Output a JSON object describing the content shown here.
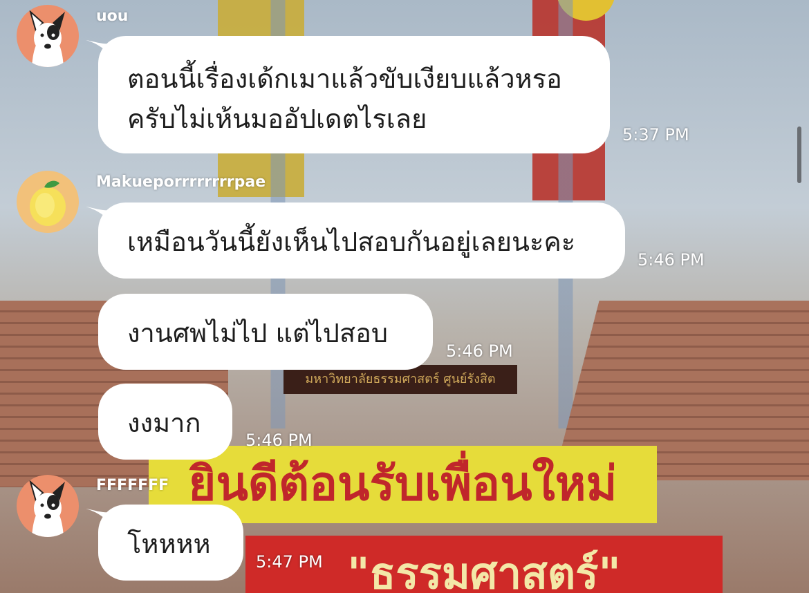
{
  "background": {
    "plaque_text": "มหาวิทยาลัยธรรมศาสตร์ ศูนย์รังสิต",
    "banner_top_text": "ยินดีต้อนรับเพื่อนใหม่",
    "banner_bottom_text": "\"ธรรมศาสตร์\""
  },
  "messages": [
    {
      "sender": "uou",
      "avatar": "dog-avatar-icon",
      "lines": [
        "ตอนนี้เรื่องเด้กเมาแล้วขับเงียบแล้วหรอ",
        "ครับไม่เห้นมออัปเดตไรเลย"
      ],
      "time": "5:37 PM"
    },
    {
      "sender": "Makueporrrrrrrrpae",
      "avatar": "lemon-avatar-icon",
      "text": "เหมือนวันนี้ยังเห็นไปสอบกันอยู่เลยนะคะ",
      "time": "5:46 PM"
    },
    {
      "text": "งานศพไม่ไป แต่ไปสอบ",
      "time": "5:46 PM"
    },
    {
      "text": "งงมาก",
      "time": "5:46 PM"
    },
    {
      "sender": "FFFFFFF",
      "avatar": "dog-avatar-icon",
      "text": "โหหหห",
      "time": "5:47 PM"
    }
  ],
  "colors": {
    "avatar_dog_bg": "#ec8f6c",
    "avatar_lemon_bg": "#f2c17a",
    "bubble": "#ffffff",
    "timestamp": "#ffffff"
  }
}
